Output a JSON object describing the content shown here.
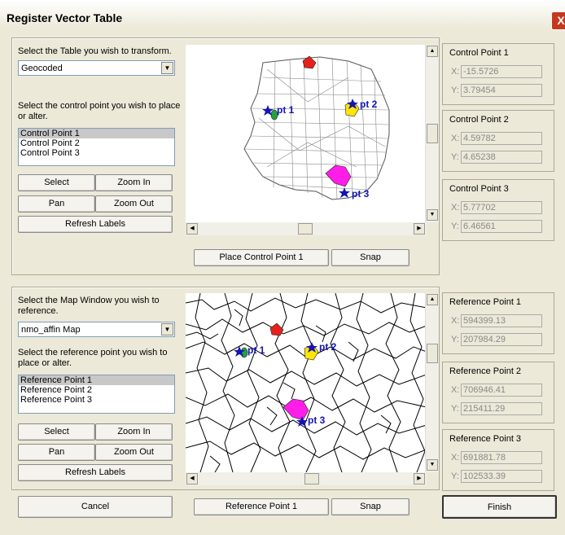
{
  "window": {
    "title": "Register Vector Table",
    "close_symbol": "X"
  },
  "top": {
    "table_prompt": "Select the Table you wish to transform.",
    "table_value": "Geocoded",
    "control_prompt": "Select the control point you wish to place or alter.",
    "control_items": [
      "Control Point 1",
      "Control Point 2",
      "Control Point 3"
    ],
    "buttons": {
      "select": "Select",
      "zoom_in": "Zoom In",
      "pan": "Pan",
      "zoom_out": "Zoom Out",
      "refresh": "Refresh Labels"
    },
    "map_labels": {
      "pt1": "pt 1",
      "pt2": "pt 2",
      "pt3": "pt 3"
    },
    "place_button": "Place Control Point 1",
    "snap_button": "Snap",
    "points": [
      {
        "title": "Control Point 1",
        "x_label": "X:",
        "x": "-15.5726",
        "y_label": "Y:",
        "y": "3.79454"
      },
      {
        "title": "Control Point 2",
        "x_label": "X:",
        "x": "4.59782",
        "y_label": "Y:",
        "y": "4.65238"
      },
      {
        "title": "Control Point 3",
        "x_label": "X:",
        "x": "5.77702",
        "y_label": "Y:",
        "y": "6.46561"
      }
    ]
  },
  "bottom": {
    "map_prompt": "Select the Map Window you wish to reference.",
    "map_value": "nmo_affin Map",
    "reference_prompt": "Select the reference point you wish to place or alter.",
    "reference_items": [
      "Reference Point 1",
      "Reference Point 2",
      "Reference Point 3"
    ],
    "buttons": {
      "select": "Select",
      "zoom_in": "Zoom In",
      "pan": "Pan",
      "zoom_out": "Zoom Out",
      "refresh": "Refresh Labels"
    },
    "map_labels": {
      "pt1": "pt 1",
      "pt2": "pt 2",
      "pt3": "pt 3"
    },
    "place_button": "Reference Point 1",
    "snap_button": "Snap",
    "points": [
      {
        "title": "Reference Point 1",
        "x_label": "X:",
        "x": "594399.13",
        "y_label": "Y:",
        "y": "207984.29"
      },
      {
        "title": "Reference Point 2",
        "x_label": "X:",
        "x": "706946.41",
        "y_label": "Y:",
        "y": "215411.29"
      },
      {
        "title": "Reference Point 3",
        "x_label": "X:",
        "x": "691881.78",
        "y_label": "Y:",
        "y": "102533.39"
      }
    ]
  },
  "footer": {
    "cancel": "Cancel",
    "finish": "Finish"
  },
  "colors": {
    "region_red": "#e8201c",
    "region_green": "#22a33a",
    "region_yellow": "#ffe600",
    "region_magenta": "#ff1ee8",
    "star_blue": "#1515b5"
  }
}
